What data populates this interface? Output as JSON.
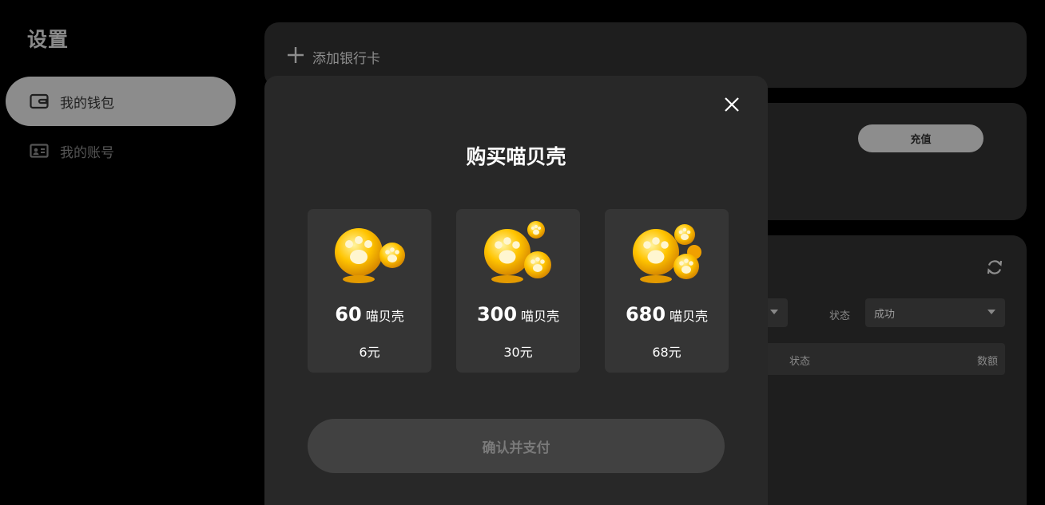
{
  "sidebar": {
    "title": "设置",
    "items": [
      {
        "label": "我的钱包",
        "icon": "wallet-icon",
        "active": true
      },
      {
        "label": "我的账号",
        "icon": "id-card-icon",
        "active": false
      }
    ]
  },
  "main": {
    "add_card_label": "添加银行卡",
    "recharge_label": "充值",
    "filters": {
      "status_label": "状态",
      "status_value": "成功"
    },
    "table": {
      "columns": [
        "状态",
        "数额"
      ]
    }
  },
  "modal": {
    "title": "购买喵贝壳",
    "packages": [
      {
        "amount": "60",
        "unit": "喵贝壳",
        "price": "6元"
      },
      {
        "amount": "300",
        "unit": "喵贝壳",
        "price": "30元"
      },
      {
        "amount": "680",
        "unit": "喵贝壳",
        "price": "68元"
      }
    ],
    "confirm_label": "确认并支付"
  },
  "colors": {
    "background": "#000000",
    "panel": "#1e1e1e",
    "modal": "#282828",
    "card": "#353535",
    "accent_gold": "#f6b800"
  }
}
